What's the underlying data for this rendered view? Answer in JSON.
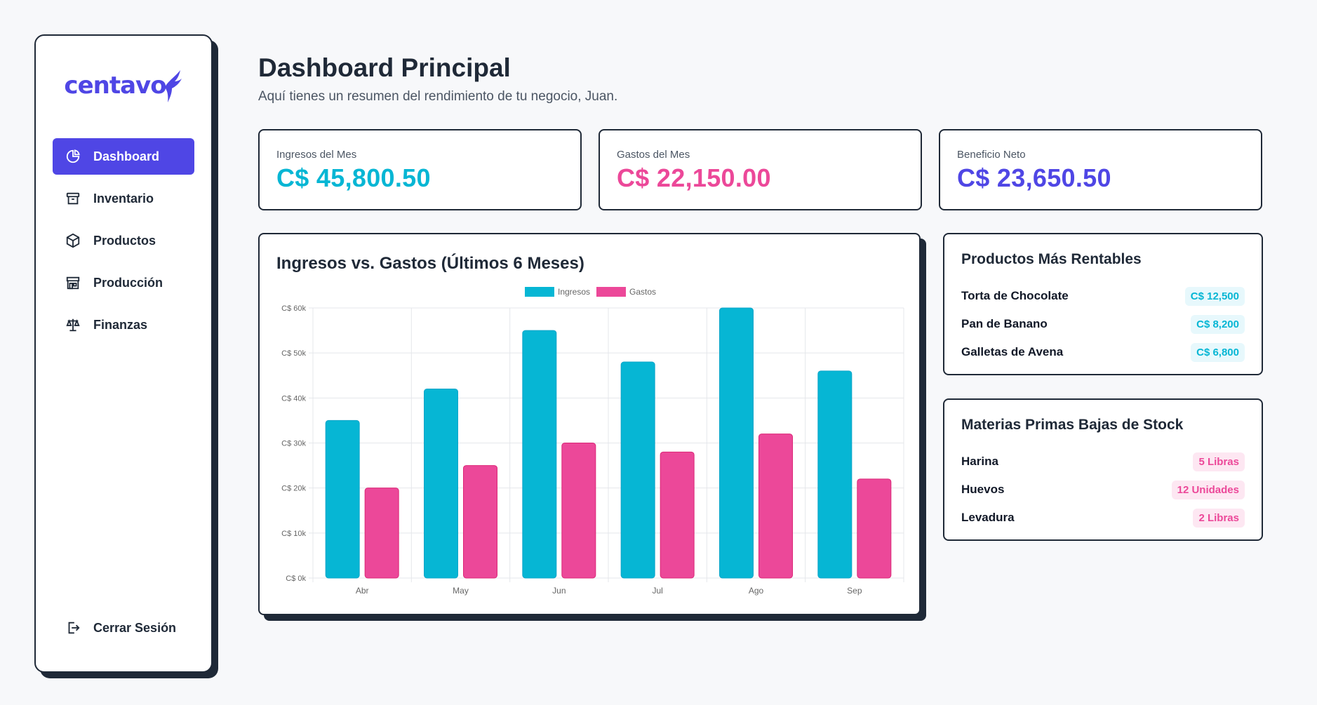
{
  "brand": {
    "logo_text": "centavo",
    "accent": "#4f46e5"
  },
  "sidebar": {
    "items": [
      {
        "label": "Dashboard",
        "icon": "pie-chart-icon",
        "active": true
      },
      {
        "label": "Inventario",
        "icon": "archive-box-icon",
        "active": false
      },
      {
        "label": "Productos",
        "icon": "cube-icon",
        "active": false
      },
      {
        "label": "Producción",
        "icon": "store-icon",
        "active": false
      },
      {
        "label": "Finanzas",
        "icon": "scale-icon",
        "active": false
      }
    ],
    "logout_label": "Cerrar Sesión"
  },
  "header": {
    "title": "Dashboard Principal",
    "subtitle": "Aquí tienes un resumen del rendimiento de tu negocio, Juan."
  },
  "stats": [
    {
      "label": "Ingresos del Mes",
      "value": "C$ 45,800.50",
      "color": "#06b6d4"
    },
    {
      "label": "Gastos del Mes",
      "value": "C$ 22,150.00",
      "color": "#ec4899"
    },
    {
      "label": "Beneficio Neto",
      "value": "C$ 23,650.50",
      "color": "#4f46e5"
    }
  ],
  "chart_card": {
    "title": "Ingresos vs. Gastos (Últimos 6 Meses)"
  },
  "chart_data": {
    "type": "bar",
    "categories": [
      "Abr",
      "May",
      "Jun",
      "Jul",
      "Ago",
      "Sep"
    ],
    "series": [
      {
        "name": "Ingresos",
        "color": "#06b6d4",
        "values": [
          35000,
          42000,
          55000,
          48000,
          60000,
          46000
        ]
      },
      {
        "name": "Gastos",
        "color": "#ec4899",
        "values": [
          20000,
          25000,
          30000,
          28000,
          32000,
          22000
        ]
      }
    ],
    "ylim": [
      0,
      60000
    ],
    "y_ticks": [
      "C$ 0k",
      "C$ 10k",
      "C$ 20k",
      "C$ 30k",
      "C$ 40k",
      "C$ 50k",
      "C$ 60k"
    ],
    "grid": true,
    "legend": "top-center"
  },
  "top_products": {
    "title": "Productos Más Rentables",
    "items": [
      {
        "name": "Torta de Chocolate",
        "value": "C$ 12,500"
      },
      {
        "name": "Pan de Banano",
        "value": "C$ 8,200"
      },
      {
        "name": "Galletas de Avena",
        "value": "C$ 6,800"
      }
    ]
  },
  "low_stock": {
    "title": "Materias Primas Bajas de Stock",
    "items": [
      {
        "name": "Harina",
        "value": "5 Libras"
      },
      {
        "name": "Huevos",
        "value": "12 Unidades"
      },
      {
        "name": "Levadura",
        "value": "2 Libras"
      }
    ]
  }
}
